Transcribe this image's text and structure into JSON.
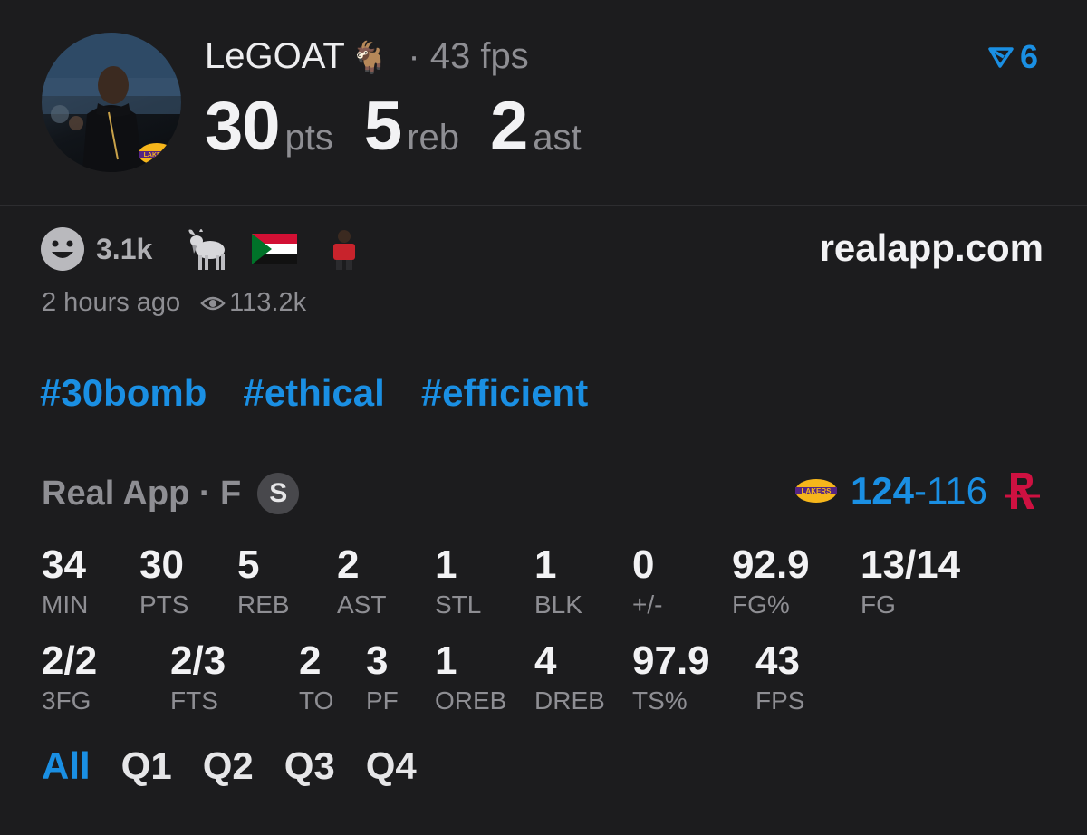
{
  "header": {
    "player_name": "LeGOAT",
    "name_emoji": "🐐",
    "fps_text": "· 43 fps",
    "stat_line": [
      {
        "value": "30",
        "unit": "pts"
      },
      {
        "value": "5",
        "unit": "reb"
      },
      {
        "value": "2",
        "unit": "ast"
      }
    ],
    "vote_count": "6",
    "vote_icon": "arrow-vote-icon",
    "avatar_badge": "lakers-logo"
  },
  "reactions": {
    "count": "3.1k",
    "icons": [
      "smiley-icon",
      "goat-icon",
      "sudan-flag-icon",
      "avatar-icon"
    ]
  },
  "site": "realapp.com",
  "meta": {
    "time": "2 hours ago",
    "views": "113.2k",
    "views_icon": "eye-icon"
  },
  "hashtags": [
    "#30bomb",
    "#ethical",
    "#efficient"
  ],
  "game": {
    "label": "Real App · F",
    "badge": "S",
    "home_score": "124",
    "separator": "-",
    "away_score": "116",
    "home_logo": "lakers-logo",
    "away_logo": "rockets-logo"
  },
  "stats_row1": [
    {
      "value": "34",
      "label": "MIN"
    },
    {
      "value": "30",
      "label": "PTS"
    },
    {
      "value": "5",
      "label": "REB"
    },
    {
      "value": "2",
      "label": "AST"
    },
    {
      "value": "1",
      "label": "STL"
    },
    {
      "value": "1",
      "label": "BLK"
    },
    {
      "value": "0",
      "label": "+/-"
    },
    {
      "value": "92.9",
      "label": "FG%"
    },
    {
      "value": "13/14",
      "label": "FG"
    }
  ],
  "stats_row2": [
    {
      "value": "2/2",
      "label": "3FG"
    },
    {
      "value": "2/3",
      "label": "FTS"
    },
    {
      "value": "2",
      "label": "TO"
    },
    {
      "value": "3",
      "label": "PF"
    },
    {
      "value": "1",
      "label": "OREB"
    },
    {
      "value": "4",
      "label": "DREB"
    },
    {
      "value": "97.9",
      "label": "TS%"
    },
    {
      "value": "43",
      "label": "FPS"
    }
  ],
  "quarters": [
    "All",
    "Q1",
    "Q2",
    "Q3",
    "Q4"
  ],
  "active_quarter": "All",
  "colors": {
    "accent": "#1a8fe3",
    "background": "#1c1c1e",
    "muted": "#8e8e93"
  }
}
